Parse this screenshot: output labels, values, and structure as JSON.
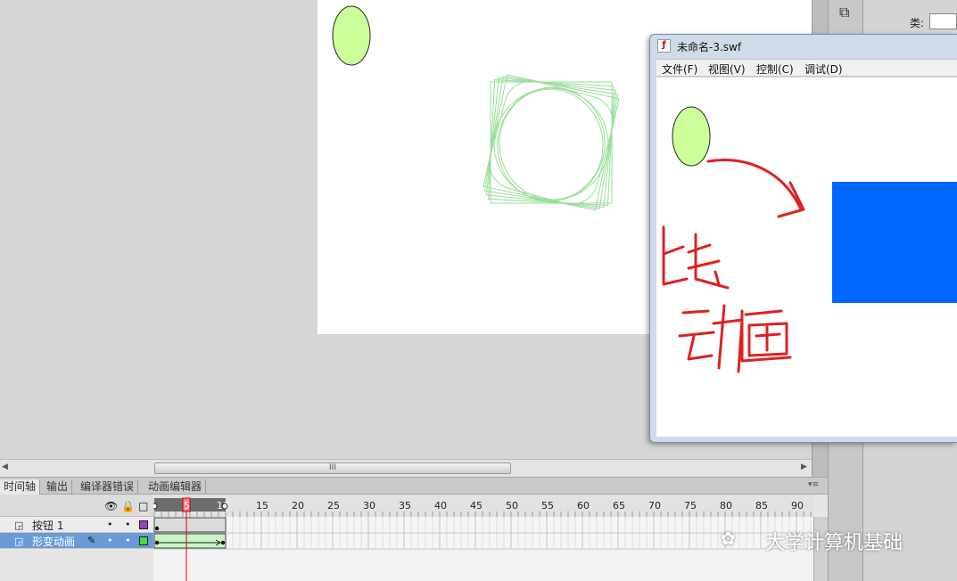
{
  "properties": {
    "class_label": "类:"
  },
  "scrollbar": {
    "thumb_grip": "III"
  },
  "panel_tabs": [
    {
      "label": "时间轴",
      "active": true
    },
    {
      "label": "输出",
      "active": false
    },
    {
      "label": "编译器错误",
      "active": false
    },
    {
      "label": "动画编辑器",
      "active": false
    }
  ],
  "timeline": {
    "current_frame": 5,
    "frame_count": 10,
    "ruler_labels": [
      "15",
      "20",
      "25",
      "30",
      "35",
      "40",
      "45",
      "50",
      "55",
      "60",
      "65",
      "70",
      "75",
      "80",
      "85",
      "90"
    ],
    "header_icons": [
      "eye-icon",
      "lock-icon",
      "outline-icon"
    ],
    "layers": [
      {
        "name": "按钮 1",
        "color": "#9a3fc7",
        "selected": false
      },
      {
        "name": "形变动画",
        "color": "#44dd44",
        "selected": true
      }
    ]
  },
  "player": {
    "title": "未命名-3.swf",
    "menu": [
      "文件(F)",
      "视图(V)",
      "控制(C)",
      "调试(D)"
    ],
    "annotation_color": "#e02020",
    "square_color": "#0066ff",
    "ellipse_color": "#ccff99"
  },
  "stage": {
    "ellipse_color": "#ccff99",
    "tween_color": "#99dd99"
  },
  "watermark": "大学计算机基础"
}
